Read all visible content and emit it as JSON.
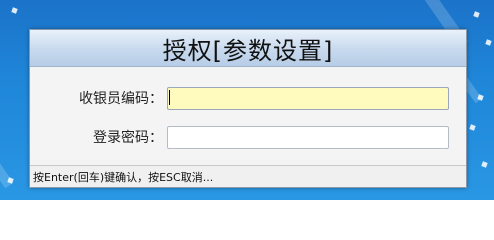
{
  "dialog": {
    "title": "授权[参数设置]",
    "fields": [
      {
        "label": "收银员编码：",
        "value": ""
      },
      {
        "label": "登录密码：",
        "value": ""
      }
    ],
    "status_text": "按Enter(回车)键确认，按ESC取消..."
  }
}
